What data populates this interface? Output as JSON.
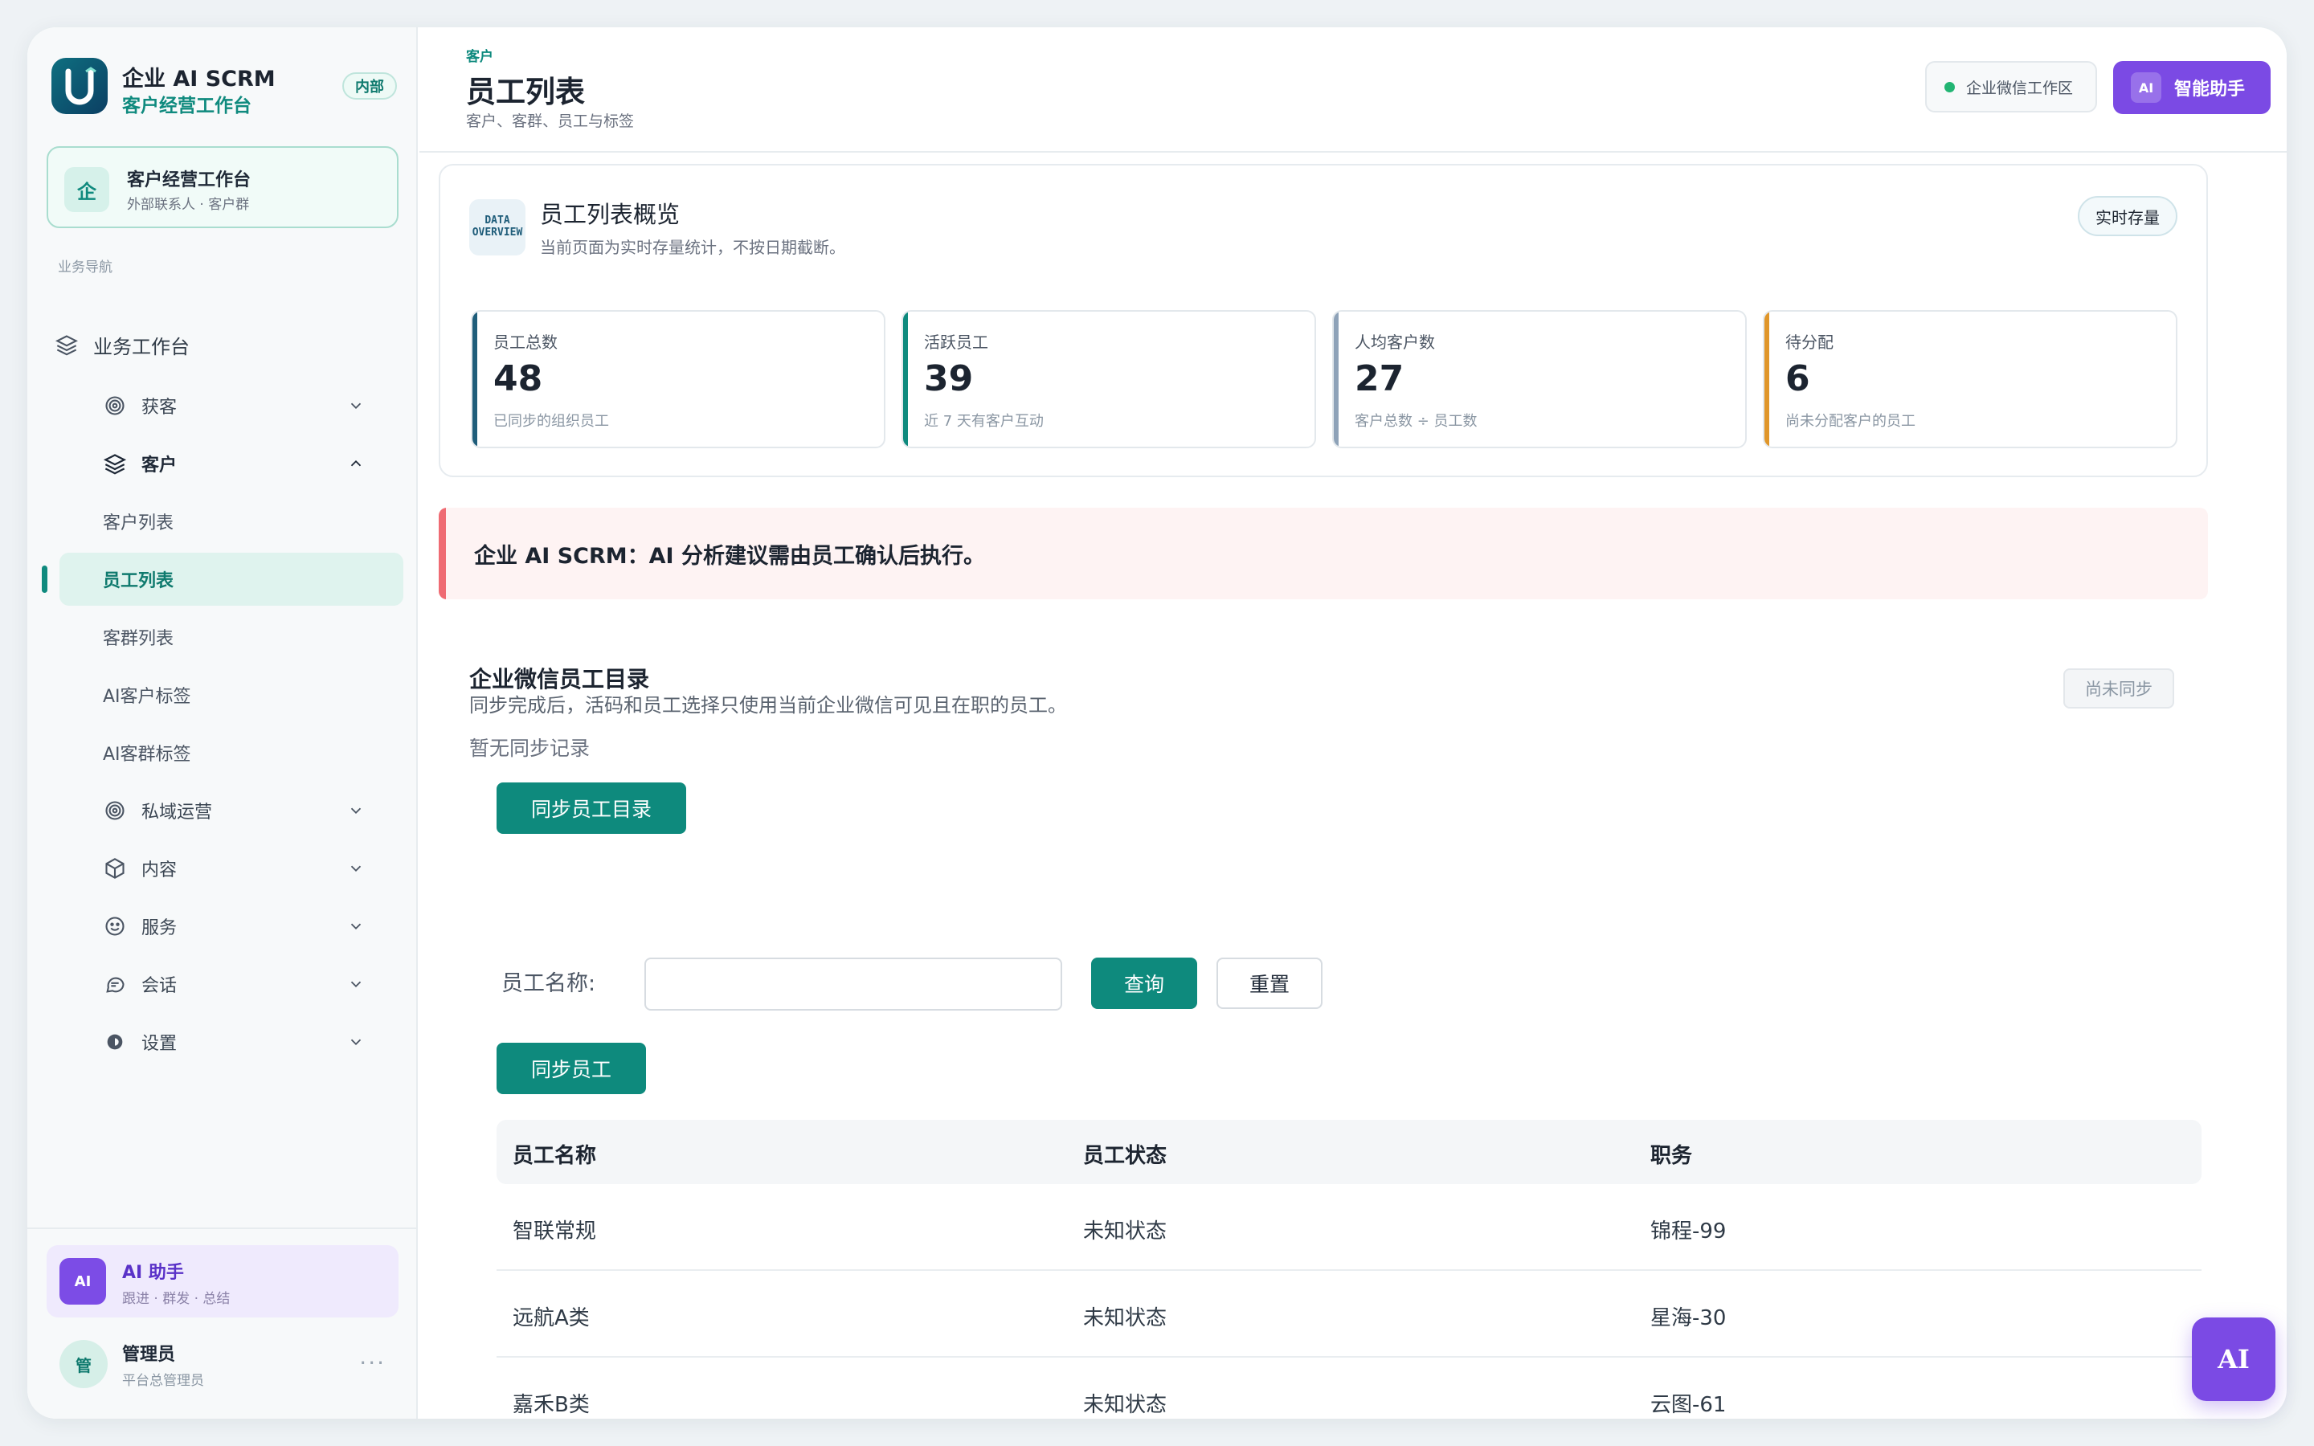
{
  "brand": {
    "title": "企业 AI SCRM",
    "subtitle": "客户经营工作台",
    "badge": "内部"
  },
  "workspace": {
    "icon_char": "企",
    "title": "客户经营工作台",
    "subtitle": "外部联系人 · 客户群"
  },
  "sidebar": {
    "section_label": "业务导航",
    "top_item": "业务工作台",
    "items": [
      {
        "label": "获客",
        "icon": "target-icon",
        "expanded": false
      },
      {
        "label": "客户",
        "icon": "layers-icon",
        "expanded": true
      },
      {
        "label": "私域运营",
        "icon": "target-icon",
        "expanded": false
      },
      {
        "label": "内容",
        "icon": "box-icon",
        "expanded": false
      },
      {
        "label": "服务",
        "icon": "smile-icon",
        "expanded": false
      },
      {
        "label": "会话",
        "icon": "chat-icon",
        "expanded": false
      },
      {
        "label": "设置",
        "icon": "gear-icon",
        "expanded": false
      }
    ],
    "children": [
      "客户列表",
      "员工列表",
      "客群列表",
      "AI客户标签",
      "AI客群标签"
    ],
    "active_child": "员工列表"
  },
  "ai_card": {
    "badge": "AI",
    "title": "AI 助手",
    "subtitle": "跟进 · 群发 · 总结"
  },
  "user": {
    "avatar": "管",
    "name": "管理员",
    "role": "平台总管理员",
    "more": "···"
  },
  "header": {
    "crumb": "客户",
    "title": "员工列表",
    "subtitle": "客户、客群、员工与标签",
    "env_label": "企业微信工作区",
    "ai_button_badge": "AI",
    "ai_button_label": "智能助手"
  },
  "overview": {
    "icon_lines": [
      "DATA",
      "OVERVIEW"
    ],
    "title": "员工列表概览",
    "subtitle": "当前页面为实时存量统计，不按日期截断。",
    "tag": "实时存量",
    "stats": [
      {
        "label": "员工总数",
        "value": "48",
        "note": "已同步的组织员工",
        "color": "#1f5d7a"
      },
      {
        "label": "活跃员工",
        "value": "39",
        "note": "近 7 天有客户互动",
        "color": "#0f8a7e"
      },
      {
        "label": "人均客户数",
        "value": "27",
        "note": "客户总数 ÷ 员工数",
        "color": "#8ea2b8"
      },
      {
        "label": "待分配",
        "value": "6",
        "note": "尚未分配客户的员工",
        "color": "#e0962a"
      }
    ]
  },
  "alert": {
    "text": "企业 AI SCRM：AI 分析建议需由员工确认后执行。"
  },
  "directory": {
    "title": "企业微信员工目录",
    "subtitle": "同步完成后，活码和员工选择只使用当前企业微信可见且在职的员工。",
    "empty": "暂无同步记录",
    "status": "尚未同步",
    "sync_button": "同步员工目录"
  },
  "search": {
    "label": "员工名称:",
    "value": "",
    "placeholder": "",
    "query_button": "查询",
    "reset_button": "重置",
    "sync_button": "同步员工"
  },
  "table": {
    "columns": [
      "员工名称",
      "员工状态",
      "职务"
    ],
    "rows": [
      [
        "智联常规",
        "未知状态",
        "锦程-99"
      ],
      [
        "远航A类",
        "未知状态",
        "星海-30"
      ],
      [
        "嘉禾B类",
        "未知状态",
        "云图-61"
      ]
    ]
  },
  "fab": {
    "label": "AI"
  }
}
